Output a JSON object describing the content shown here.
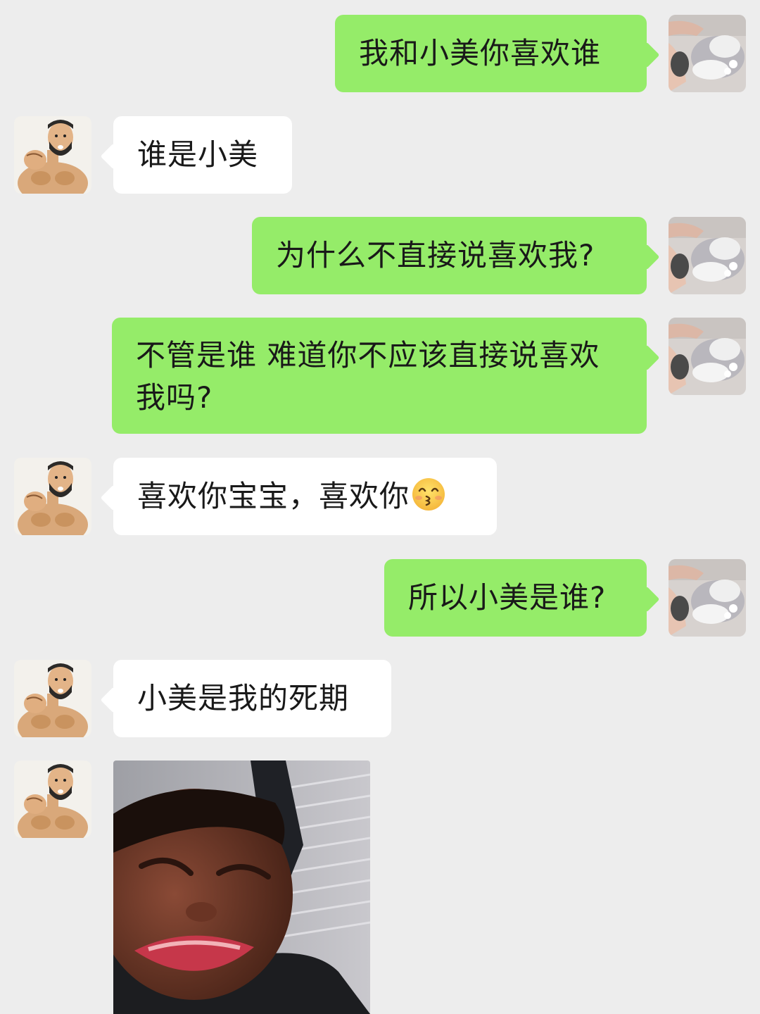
{
  "messages": [
    {
      "side": "me",
      "text": "我和小美你喜欢谁"
    },
    {
      "side": "them",
      "text": "谁是小美"
    },
    {
      "side": "me",
      "text": "为什么不直接说喜欢我?"
    },
    {
      "side": "me",
      "text": "不管是谁 难道你不应该直接说喜欢我吗?"
    },
    {
      "side": "them",
      "text": "喜欢你宝宝，喜欢你",
      "emoji": "kissing-face-icon"
    },
    {
      "side": "me",
      "text": "所以小美是谁?"
    },
    {
      "side": "them",
      "text": "小美是我的死期"
    },
    {
      "side": "them",
      "type": "image",
      "image": "crying-boy-meme"
    }
  ],
  "avatars": {
    "me": "cat-photo-avatar",
    "them": "bearded-muscle-man-avatar"
  },
  "colors": {
    "background": "#ededed",
    "my_bubble": "#95ec69",
    "their_bubble": "#ffffff",
    "text": "#191919"
  }
}
